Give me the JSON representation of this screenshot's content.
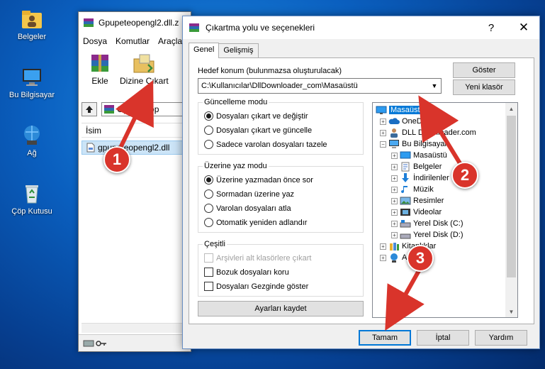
{
  "desktop": {
    "icons": [
      {
        "label": "Belgeler",
        "icon": "folder-user-icon"
      },
      {
        "label": "Bu Bilgisayar",
        "icon": "computer-icon"
      },
      {
        "label": "Ağ",
        "icon": "network-icon"
      },
      {
        "label": "Çöp Kutusu",
        "icon": "recycle-bin-icon"
      }
    ]
  },
  "rar": {
    "title": "Gpupeteopengl2.dll.z",
    "menu": [
      "Dosya",
      "Komutlar",
      "Araçla"
    ],
    "tools": [
      {
        "label": "Ekle"
      },
      {
        "label": "Dizine Çıkart"
      }
    ],
    "path": "Gpupeteop",
    "list_header": "İsim",
    "file": "gpupeteopengl2.dll"
  },
  "dialog": {
    "title": "Çıkartma yolu ve seçenekleri",
    "help": "?",
    "close": "✕",
    "tabs": [
      "Genel",
      "Gelişmiş"
    ],
    "dest_label": "Hedef konum (bulunmazsa oluşturulacak)",
    "dest_value": "C:\\Kullanıcılar\\DllDownloader_com\\Masaüstü",
    "show_btn": "Göster",
    "new_folder_btn": "Yeni klasör",
    "update_mode": {
      "title": "Güncelleme modu",
      "options": [
        "Dosyaları çıkart ve değiştir",
        "Dosyaları çıkart ve güncelle",
        "Sadece varolan dosyaları tazele"
      ],
      "selected": 0
    },
    "overwrite_mode": {
      "title": "Üzerine yaz modu",
      "options": [
        "Üzerine yazmadan önce sor",
        "Sormadan üzerine yaz",
        "Varolan dosyaları atla",
        "Otomatik yeniden adlandır"
      ],
      "selected": 0
    },
    "misc": {
      "title": "Çeşitli",
      "options": [
        "Arşivleri alt klasörlere çıkart",
        "Bozuk dosyaları koru",
        "Dosyaları Gezginde göster"
      ]
    },
    "save_btn": "Ayarları kaydet",
    "tree": [
      {
        "label": "Masaüstü",
        "icon": "desktop-icon",
        "level": 0,
        "exp": "",
        "selected": true
      },
      {
        "label": "OneDrive",
        "icon": "onedrive-icon",
        "level": 1,
        "exp": "+"
      },
      {
        "label": "DLL Downloader.com",
        "icon": "user-icon",
        "level": 1,
        "exp": "+"
      },
      {
        "label": "Bu Bilgisayar",
        "icon": "computer-icon",
        "level": 1,
        "exp": "−"
      },
      {
        "label": "Masaüstü",
        "icon": "desktop-icon",
        "level": 2,
        "exp": "+"
      },
      {
        "label": "Belgeler",
        "icon": "documents-icon",
        "level": 2,
        "exp": "+"
      },
      {
        "label": "İndirilenler",
        "icon": "download-icon",
        "level": 2,
        "exp": "+"
      },
      {
        "label": "Müzik",
        "icon": "music-icon",
        "level": 2,
        "exp": "+"
      },
      {
        "label": "Resimler",
        "icon": "pictures-icon",
        "level": 2,
        "exp": "+"
      },
      {
        "label": "Videolar",
        "icon": "videos-icon",
        "level": 2,
        "exp": "+"
      },
      {
        "label": "Yerel Disk (C:)",
        "icon": "drive-icon",
        "level": 2,
        "exp": "+"
      },
      {
        "label": "Yerel Disk (D:)",
        "icon": "drive-icon",
        "level": 2,
        "exp": "+"
      },
      {
        "label": "Kitaplıklar",
        "icon": "libraries-icon",
        "level": 1,
        "exp": "+"
      },
      {
        "label": "Ağ",
        "icon": "network-icon",
        "level": 1,
        "exp": "+"
      }
    ],
    "ok_btn": "Tamam",
    "cancel_btn": "İptal",
    "help_btn": "Yardım"
  },
  "annotations": [
    "1",
    "2",
    "3"
  ],
  "colors": {
    "accent": "#0078d7",
    "badge": "#d9342b"
  }
}
